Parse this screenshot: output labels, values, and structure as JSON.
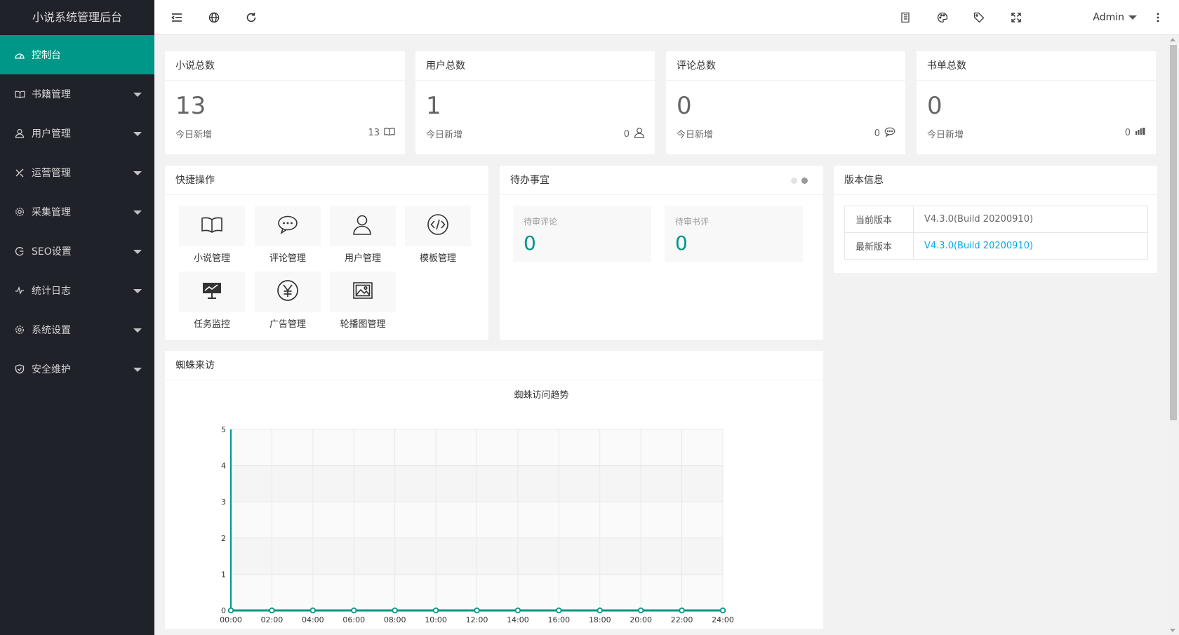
{
  "app": {
    "title": "小说系统管理后台"
  },
  "colors": {
    "accent": "#009688",
    "sidebar_bg": "#20222a",
    "link": "#01aaed"
  },
  "sidebar": {
    "items": [
      {
        "label": "控制台",
        "icon": "dashboard-icon"
      },
      {
        "label": "书籍管理",
        "icon": "book-icon"
      },
      {
        "label": "用户管理",
        "icon": "user-icon"
      },
      {
        "label": "运营管理",
        "icon": "tools-icon"
      },
      {
        "label": "采集管理",
        "icon": "gear-icon"
      },
      {
        "label": "SEO设置",
        "icon": "seo-icon"
      },
      {
        "label": "统计日志",
        "icon": "pulse-icon"
      },
      {
        "label": "系统设置",
        "icon": "settings-icon"
      },
      {
        "label": "安全维护",
        "icon": "shield-icon"
      }
    ]
  },
  "header": {
    "icons": [
      "menu-fold-icon",
      "globe-icon",
      "refresh-icon",
      "note-icon",
      "theme-icon",
      "tag-icon",
      "fullscreen-icon",
      "more-icon"
    ],
    "user": "Admin"
  },
  "stats": [
    {
      "title": "小说总数",
      "value": "13",
      "sub_label": "今日新增",
      "today": "13",
      "icon": "book-icon"
    },
    {
      "title": "用户总数",
      "value": "1",
      "sub_label": "今日新增",
      "today": "0",
      "icon": "user-icon"
    },
    {
      "title": "评论总数",
      "value": "0",
      "sub_label": "今日新增",
      "today": "0",
      "icon": "comment-icon"
    },
    {
      "title": "书单总数",
      "value": "0",
      "sub_label": "今日新增",
      "today": "0",
      "icon": "list-icon"
    }
  ],
  "quick": {
    "title": "快捷操作",
    "items": [
      {
        "label": "小说管理",
        "icon": "book-icon"
      },
      {
        "label": "评论管理",
        "icon": "comment-icon"
      },
      {
        "label": "用户管理",
        "icon": "user-icon"
      },
      {
        "label": "模板管理",
        "icon": "code-icon"
      },
      {
        "label": "任务监控",
        "icon": "monitor-icon"
      },
      {
        "label": "广告管理",
        "icon": "yen-icon"
      },
      {
        "label": "轮播图管理",
        "icon": "image-icon"
      }
    ]
  },
  "todo": {
    "title": "待办事宜",
    "items": [
      {
        "label": "待审评论",
        "value": "0"
      },
      {
        "label": "待审书评",
        "value": "0"
      }
    ]
  },
  "version": {
    "title": "版本信息",
    "rows": [
      {
        "key": "当前版本",
        "value": "V4.3.0(Build 20200910)",
        "link": false
      },
      {
        "key": "最新版本",
        "value": "V4.3.0(Build 20200910)",
        "link": true
      }
    ]
  },
  "spider": {
    "title": "蜘蛛来访"
  },
  "chart_data": {
    "type": "line",
    "title": "蜘蛛访问趋势",
    "x": [
      "00:00",
      "02:00",
      "04:00",
      "06:00",
      "08:00",
      "10:00",
      "12:00",
      "14:00",
      "16:00",
      "18:00",
      "20:00",
      "22:00",
      "24:00"
    ],
    "series": [
      {
        "values": [
          0,
          0,
          0,
          0,
          0,
          0,
          0,
          0,
          0,
          0,
          0,
          0,
          0
        ]
      }
    ],
    "ylim": [
      0,
      5
    ],
    "yticks": [
      0,
      1,
      2,
      3,
      4,
      5
    ],
    "grid": true,
    "color": "#009688"
  }
}
